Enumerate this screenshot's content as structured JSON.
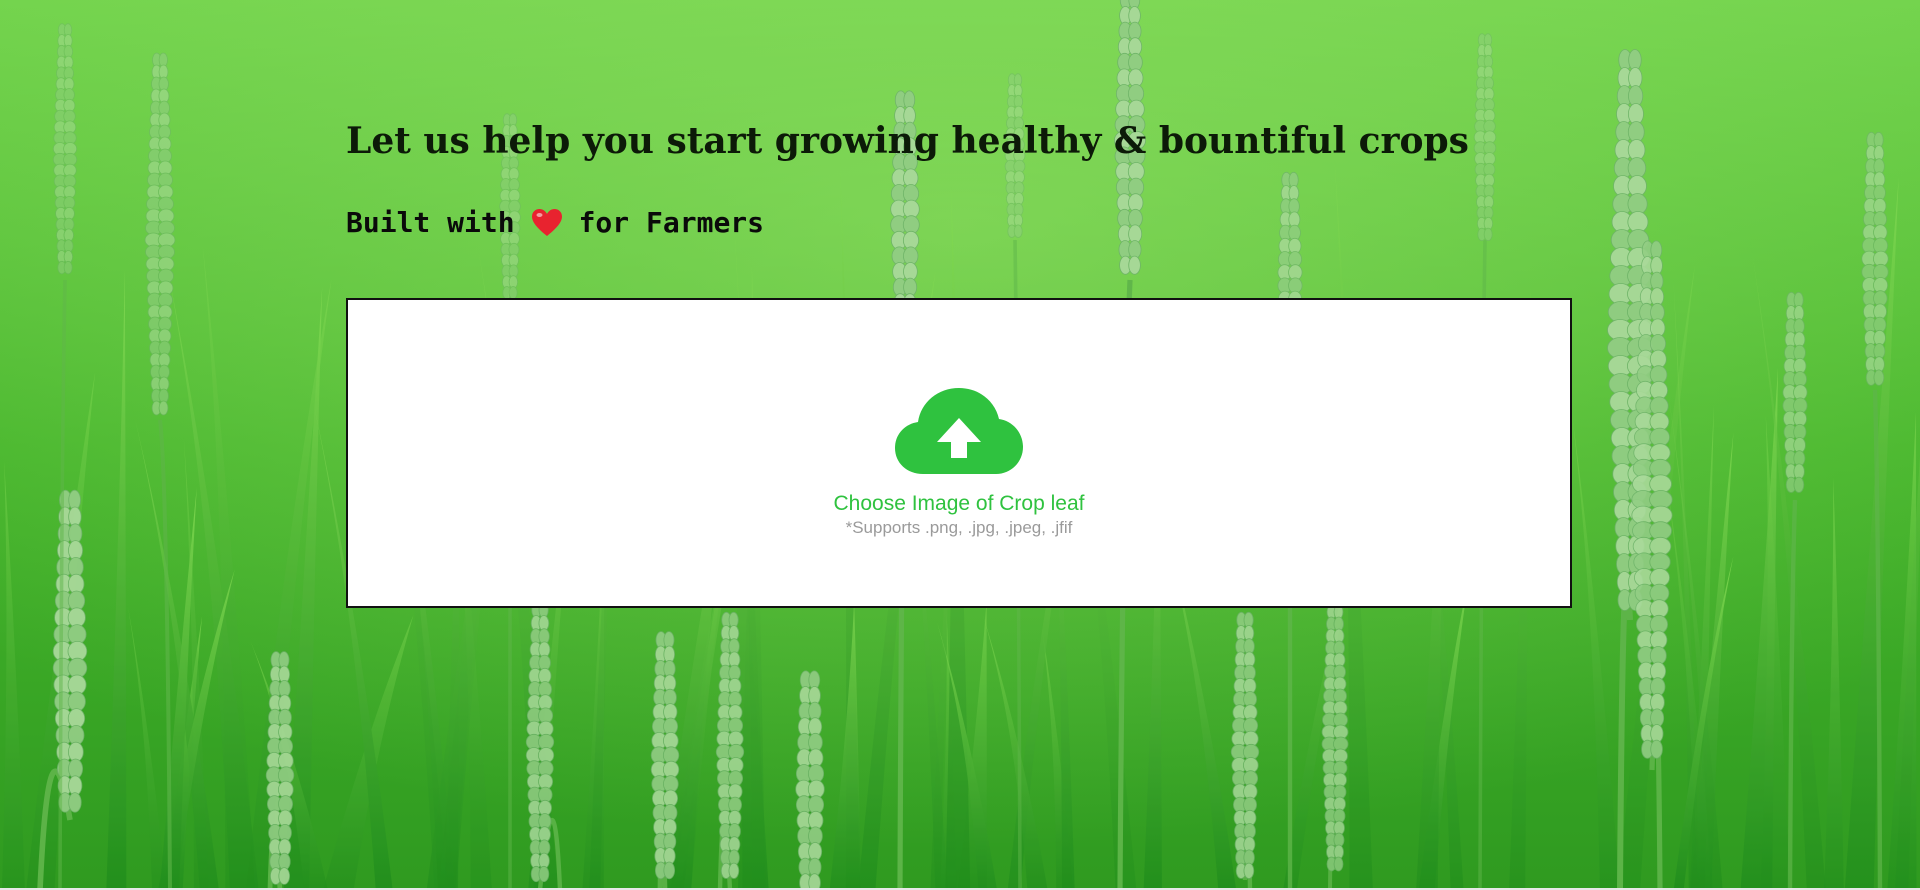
{
  "hero": {
    "headline": "Let us help you start growing healthy & bountiful crops",
    "tagline_prefix": "Built with",
    "tagline_suffix": "for Farmers",
    "heart_icon": "heart-icon"
  },
  "upload": {
    "icon": "cloud-upload-icon",
    "label": "Choose Image of Crop leaf",
    "hint": "*Supports .png, .jpg, .jpeg, .jfif",
    "accept": ".png,.jpg,.jpeg,.jfif"
  },
  "colors": {
    "accent": "#2fc23f",
    "heart": "#e8232f",
    "hint": "#9a9a9a",
    "background": "#3fae2a"
  }
}
